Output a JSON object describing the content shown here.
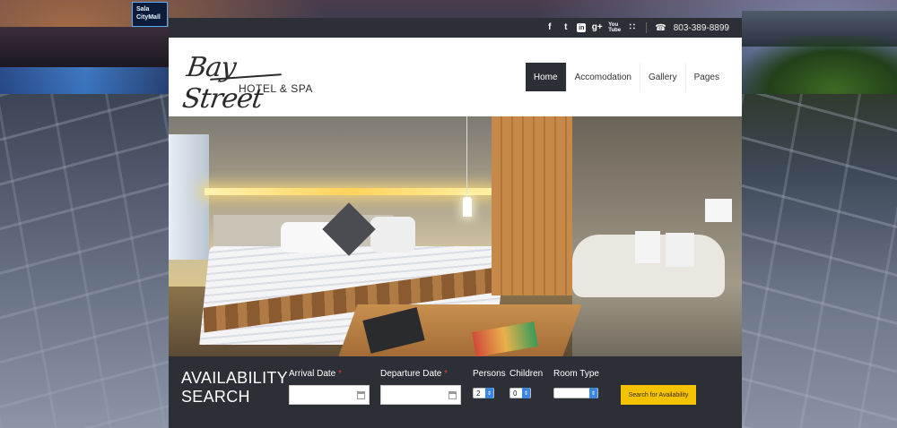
{
  "topbar": {
    "social": [
      {
        "icon": "facebook-icon",
        "glyph": "f"
      },
      {
        "icon": "twitter-icon",
        "glyph": "t"
      },
      {
        "icon": "linkedin-icon",
        "glyph": "in"
      },
      {
        "icon": "google-plus-icon",
        "glyph": "g+"
      },
      {
        "icon": "youtube-icon",
        "glyph": "You Tube"
      },
      {
        "icon": "rss-icon",
        "glyph": "∷"
      }
    ],
    "phone_icon_glyph": "☎",
    "phone": "803-389-8899"
  },
  "logo": {
    "script": "Bay Street",
    "sub": "HOTEL & SPA"
  },
  "nav": {
    "items": [
      "Home",
      "Accomodation",
      "Gallery",
      "Pages"
    ],
    "active": "Home"
  },
  "search": {
    "title": "AVAILABILITY\nSEARCH",
    "arrival_label": "Arrival Date",
    "departure_label": "Departure Date",
    "required_mark": "*",
    "persons_label": "Persons",
    "persons_value": "2",
    "children_label": "Children",
    "children_value": "0",
    "room_type_label": "Room Type",
    "room_type_value": "",
    "button_label": "Search for Availability"
  },
  "colors": {
    "dark": "#2c2f35",
    "accent": "#f5c200",
    "required": "#e03c3c"
  }
}
